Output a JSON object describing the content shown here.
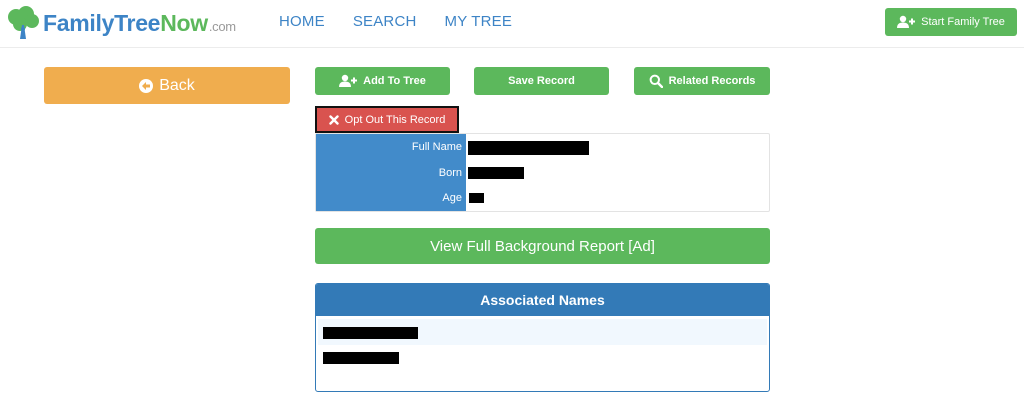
{
  "header": {
    "logo": {
      "family": "FamilyTree",
      "now": "Now",
      "com": ".com"
    },
    "nav": [
      "HOME",
      "SEARCH",
      "MY TREE"
    ],
    "start_button": "Start Family Tree"
  },
  "back_button": "Back",
  "actions": {
    "add_to_tree": "Add To Tree",
    "save_record": "Save Record",
    "related_records": "Related Records",
    "opt_out": "Opt Out This Record"
  },
  "record": {
    "fields": [
      {
        "label": "Full Name",
        "value": "[redacted]"
      },
      {
        "label": "Born",
        "value": "[redacted]"
      },
      {
        "label": "Age",
        "value": "[redacted]"
      }
    ]
  },
  "report_button": "View Full Background Report [Ad]",
  "associated_names": {
    "title": "Associated Names",
    "items": [
      "[redacted]",
      "[redacted]"
    ]
  },
  "colors": {
    "brand_blue": "#3d84c6",
    "brand_green": "#5cb85c",
    "back_orange": "#f0ad4e",
    "danger_red": "#d9534f",
    "panel_blue": "#337ab7",
    "label_blue": "#428bca"
  },
  "icons": {
    "logo": "tree-icon",
    "start": "user-plus-icon",
    "back": "arrow-left-icon",
    "add": "user-plus-icon",
    "related": "search-icon",
    "optout": "close-icon"
  }
}
